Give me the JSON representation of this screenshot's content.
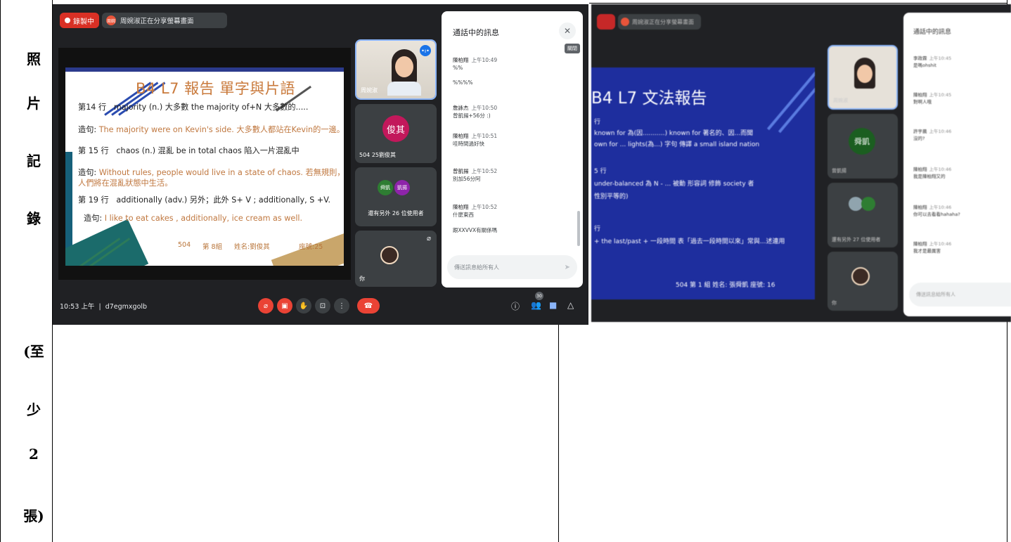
{
  "row_label": {
    "top": [
      "照",
      "片",
      "記",
      "錄"
    ],
    "bottom": [
      "(至",
      "少",
      "2",
      "張)"
    ]
  },
  "meet1": {
    "recording_label": "錄製中",
    "share_avatar": "周婉",
    "share_text": "周婉淑正在分享螢幕畫面",
    "slide": {
      "title": "B4 L7 報告 單字與片語",
      "lines": [
        {
          "label": "第14 行",
          "text": "majority (n.) 大多數   the majority of+N  大多數的....."
        },
        {
          "label": "造句:",
          "text": "The majority were on Kevin's side. 大多數人都站在Kevin的一邊。"
        },
        {
          "label": "第 15 行",
          "text": "chaos (n.) 混亂   be in total chaos 陷入一片混亂中"
        },
        {
          "label": "造句:",
          "text": "Without rules, people would live in a state of chaos. 若無規則，"
        },
        {
          "label": "",
          "text": "人們將在混亂狀態中生活。"
        },
        {
          "label": "第 19 行",
          "text": "additionally (adv.) 另外；此外  S+ V ; additionally, S +V."
        },
        {
          "label": "造句:",
          "text": "I like to eat cakes , additionally, ice cream as well."
        }
      ],
      "footer": {
        "class": "504",
        "group": "第  8組",
        "name": "姓名:劉俊其",
        "seat": "座號:25"
      }
    },
    "tiles": {
      "teacher_name": "周婉淑",
      "student_avatar": "俊其",
      "student_name": "504 25劉俊其",
      "others_avatars": [
        "舜凱",
        "凱揚"
      ],
      "others_text": "還有另外 26 位使用者",
      "you_label": "你"
    },
    "chat": {
      "title": "通話中的訊息",
      "close_tooltip": "關閉",
      "messages": [
        {
          "who": "陳柏翔",
          "time": "上午10:49",
          "body": "%%"
        },
        {
          "who": "",
          "time": "",
          "body": "%%%%"
        },
        {
          "who": "詹詠杰",
          "time": "上午10:50",
          "body": "曾凱揚+56分 :)"
        },
        {
          "who": "陳柏翔",
          "time": "上午10:51",
          "body": "哇時間過好快"
        },
        {
          "who": "曾凱揚",
          "time": "上午10:52",
          "body": "別加56分阿"
        },
        {
          "who": "陳柏翔",
          "time": "上午10:52",
          "body": "什麼東西"
        },
        {
          "who": "",
          "time": "",
          "body": "跟XXVVX有關係嗎"
        }
      ],
      "input_placeholder": "傳送訊息給所有人"
    },
    "bottom_bar": {
      "time": "10:53 上午",
      "meeting_code": "d7egmxgolb",
      "participants_badge": "30"
    }
  },
  "meet2": {
    "share_text": "周婉淑正在分享螢幕畫面",
    "slide": {
      "title": "B4  L7  文法報告",
      "lines": [
        "行",
        "known for 為(因...........)  known for  著名的、因...而聞",
        "own for ... lights(為...) 字句 傳譯 a small island nation",
        "5 行",
        "under-balanced 為 N - ... 被動 形容詞 修飾 society  者",
        "性別平等的)",
        "行",
        "+ the last/past + 一段時間 表「過去一段時間以來」常與...述連用"
      ],
      "footer": "504 第 1 組  姓名: 張舜凱   座號: 16"
    },
    "tile_names": [
      "周婉淑",
      "曾凱揚",
      "還有另外 27 位使用者",
      "你"
    ],
    "tile_avatar": "舜凱",
    "chat": {
      "title": "通話中的訊息",
      "messages": [
        {
          "who": "李政霖",
          "time": "上午10:45",
          "body": "是嗎ohshit"
        },
        {
          "who": "陳柏翔",
          "time": "上午10:45",
          "body": "對啊人哦"
        },
        {
          "who": "許宇晨",
          "time": "上午10:46",
          "body": "沒的?"
        },
        {
          "who": "陳柏翔",
          "time": "上午10:46",
          "body": "我是陳柏翔又的"
        },
        {
          "who": "陳柏翔",
          "time": "上午10:46",
          "body": "你可以去看看hahaha?"
        },
        {
          "who": "陳柏翔",
          "time": "上午10:46",
          "body": "我才是最厲害"
        }
      ],
      "input_placeholder": "傳送訊息給所有人"
    }
  }
}
